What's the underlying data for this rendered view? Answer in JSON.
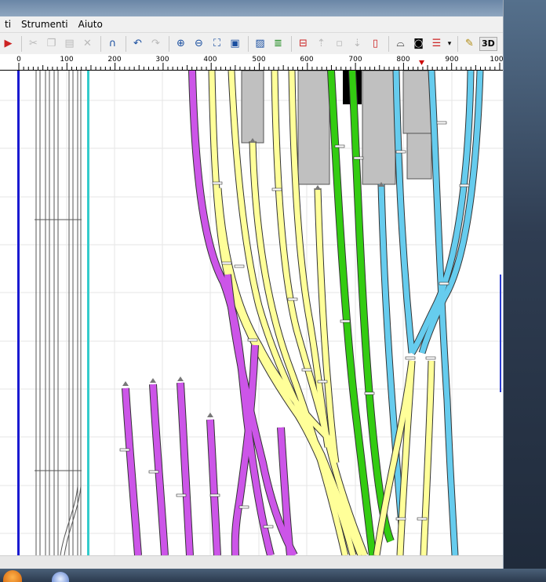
{
  "menubar": {
    "items": [
      "ti",
      "Strumenti",
      "Aiuto"
    ]
  },
  "toolbar": {
    "view_3d_label": "3D"
  },
  "ruler": {
    "ticks": [
      "0",
      "100",
      "200",
      "300",
      "400",
      "500",
      "600",
      "700",
      "800",
      "900",
      "100"
    ]
  },
  "colors": {
    "siding_purple": "#cc55e8",
    "track_yellow": "#ffff99",
    "track_green": "#33cc11",
    "track_blue": "#66ccee",
    "platform_gray": "#c0c0c0",
    "rail_blue": "#1a1ad0",
    "rail_cyan": "#33cccc"
  }
}
